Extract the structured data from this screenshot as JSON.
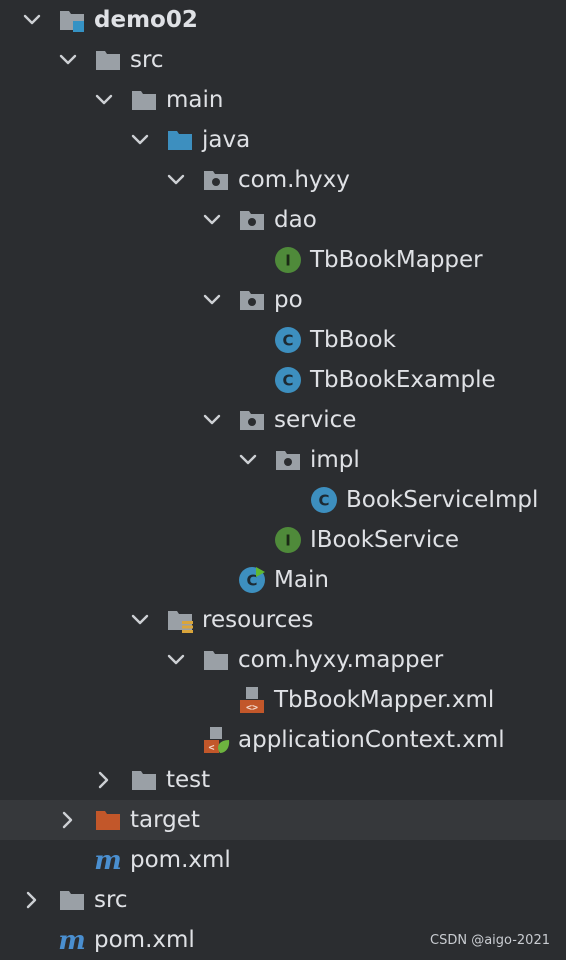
{
  "tree": [
    {
      "label": "demo02",
      "depth": 0,
      "arrow": "down",
      "icon": "module-folder-icon",
      "bold": true
    },
    {
      "label": "src",
      "depth": 1,
      "arrow": "down",
      "icon": "folder-icon"
    },
    {
      "label": "main",
      "depth": 2,
      "arrow": "down",
      "icon": "folder-icon"
    },
    {
      "label": "java",
      "depth": 3,
      "arrow": "down",
      "icon": "source-folder-icon"
    },
    {
      "label": "com.hyxy",
      "depth": 4,
      "arrow": "down",
      "icon": "package-icon"
    },
    {
      "label": "dao",
      "depth": 5,
      "arrow": "down",
      "icon": "package-icon"
    },
    {
      "label": "TbBookMapper",
      "depth": 6,
      "arrow": "none",
      "icon": "interface-icon"
    },
    {
      "label": "po",
      "depth": 5,
      "arrow": "down",
      "icon": "package-icon"
    },
    {
      "label": "TbBook",
      "depth": 6,
      "arrow": "none",
      "icon": "class-icon"
    },
    {
      "label": "TbBookExample",
      "depth": 6,
      "arrow": "none",
      "icon": "class-icon"
    },
    {
      "label": "service",
      "depth": 5,
      "arrow": "down",
      "icon": "package-icon"
    },
    {
      "label": "impl",
      "depth": 6,
      "arrow": "down",
      "icon": "package-icon"
    },
    {
      "label": "BookServiceImpl",
      "depth": 7,
      "arrow": "none",
      "icon": "class-icon"
    },
    {
      "label": "IBookService",
      "depth": 6,
      "arrow": "none",
      "icon": "interface-icon"
    },
    {
      "label": "Main",
      "depth": 5,
      "arrow": "none",
      "icon": "main-class-icon"
    },
    {
      "label": "resources",
      "depth": 3,
      "arrow": "down",
      "icon": "resources-folder-icon"
    },
    {
      "label": "com.hyxy.mapper",
      "depth": 4,
      "arrow": "down",
      "icon": "folder-icon"
    },
    {
      "label": "TbBookMapper.xml",
      "depth": 5,
      "arrow": "none",
      "icon": "xml-file-icon"
    },
    {
      "label": "applicationContext.xml",
      "depth": 4,
      "arrow": "none",
      "icon": "spring-xml-icon"
    },
    {
      "label": "test",
      "depth": 2,
      "arrow": "right",
      "icon": "folder-icon"
    },
    {
      "label": "target",
      "depth": 1,
      "arrow": "right",
      "icon": "excluded-folder-icon",
      "selected": true
    },
    {
      "label": "pom.xml",
      "depth": 1,
      "arrow": "none",
      "icon": "maven-icon"
    },
    {
      "label": "src",
      "depth": 0,
      "arrow": "right",
      "icon": "folder-icon"
    },
    {
      "label": "pom.xml",
      "depth": 0,
      "arrow": "none",
      "icon": "maven-icon"
    }
  ],
  "watermark": "CSDN @aigo-2021",
  "colors": {
    "background": "#2b2d30",
    "selected_row": "#36383b",
    "text": "#dfe1e5",
    "folder": "#9aa0a6",
    "source_folder": "#3d8fbf",
    "excluded_folder": "#c2572a",
    "class_icon": "#3d8fbf",
    "interface_icon": "#4f8a3a",
    "maven": "#4a8fd0"
  }
}
